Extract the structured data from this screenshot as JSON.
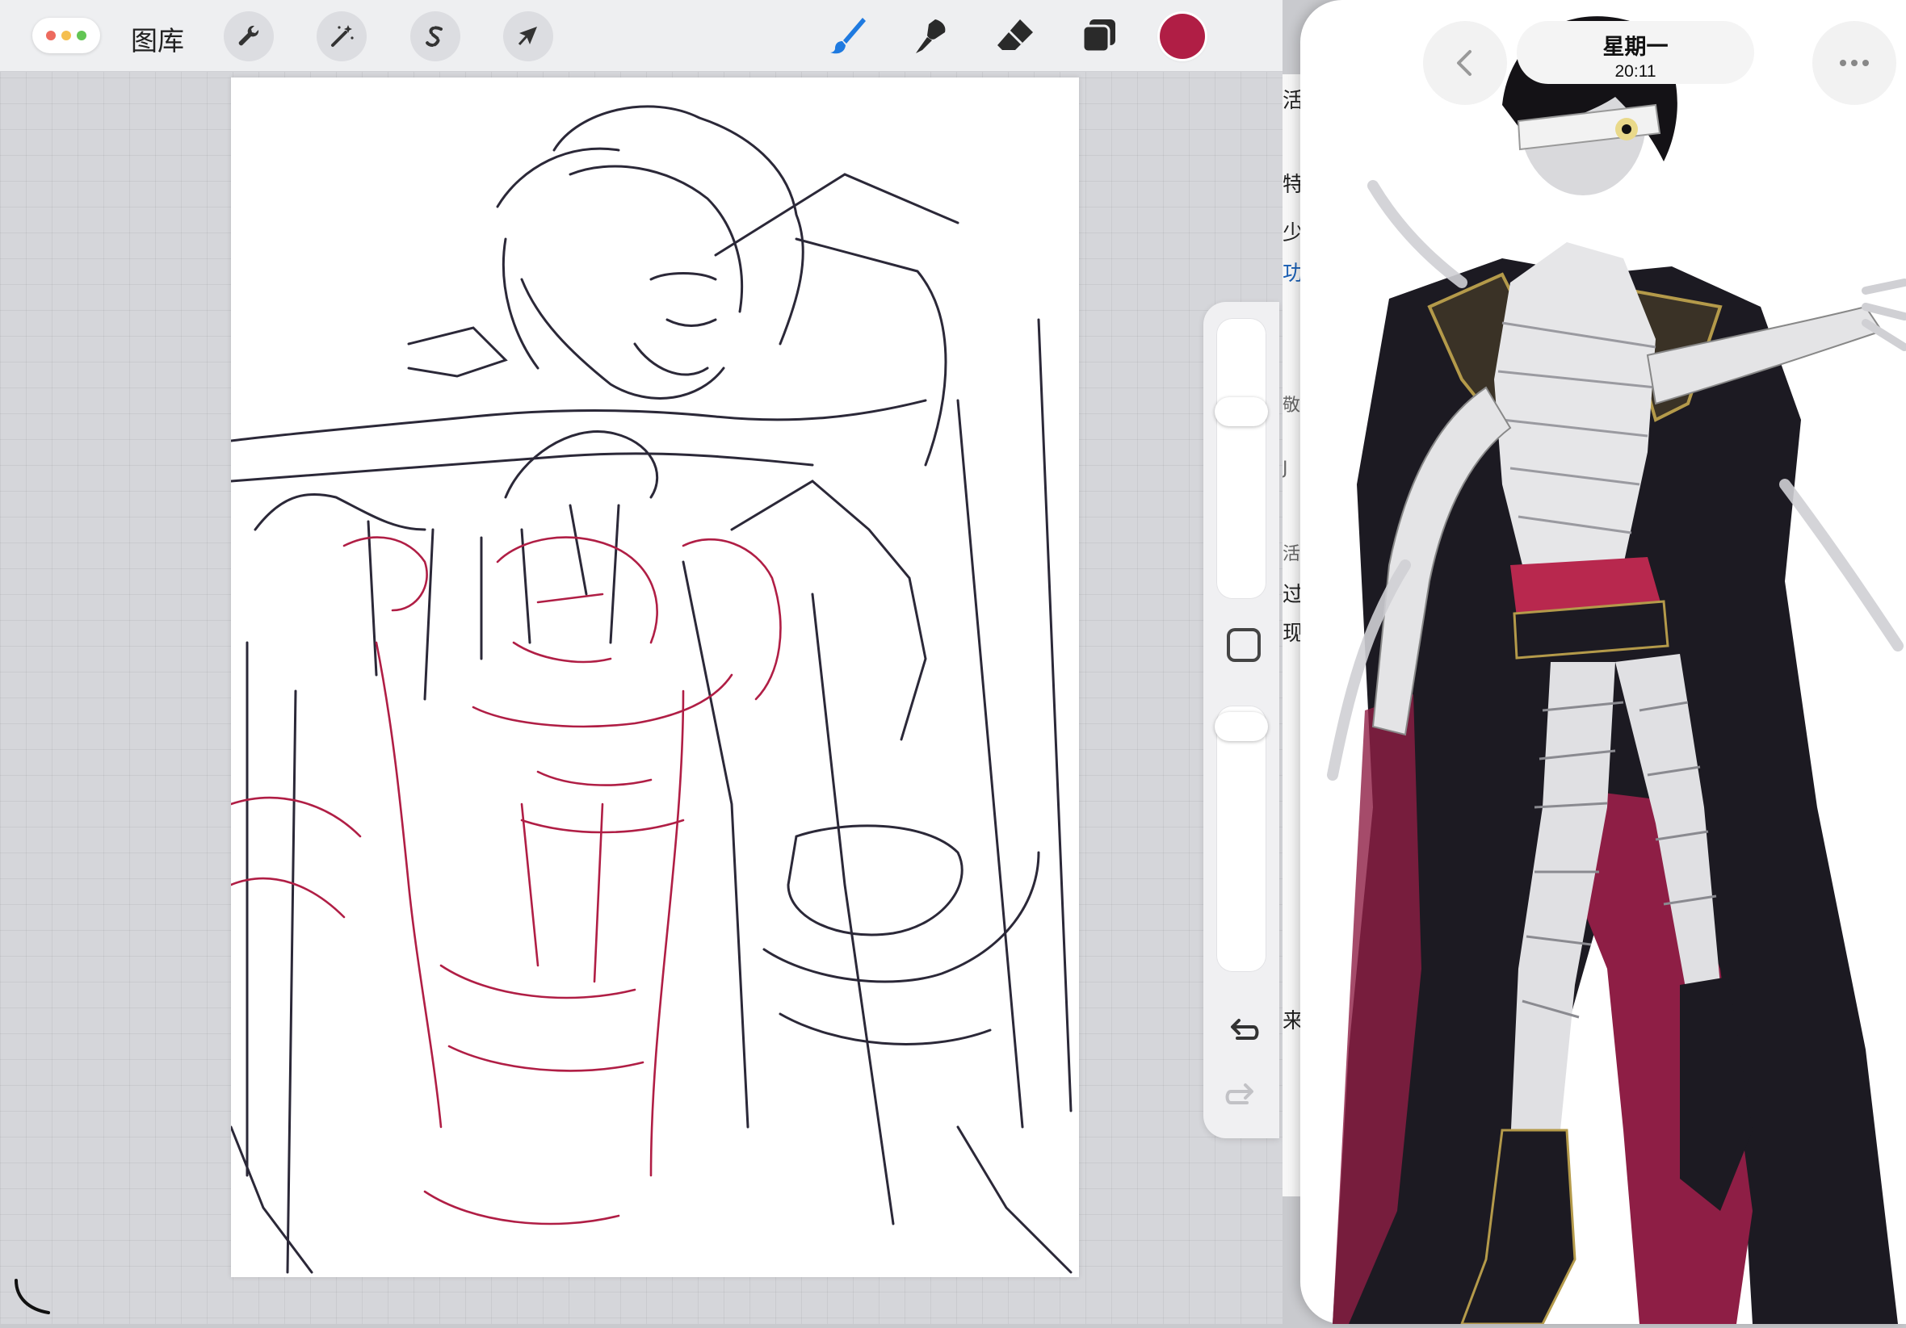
{
  "procreate": {
    "gallery_label": "图库",
    "window_dots": [
      "#ed6a5e",
      "#f5bf4f",
      "#62c554"
    ],
    "left_tools": [
      "wrench-icon",
      "magic-wand-icon",
      "selection-s-icon",
      "arrow-cursor-icon"
    ],
    "right_tools": [
      "brush-icon",
      "smudge-icon",
      "eraser-icon",
      "layers-icon"
    ],
    "active_tool_color": "#1f7ae0",
    "current_color": "#b01e45"
  },
  "safari": {
    "title": "星期一",
    "subtitle": "20:11",
    "back_icon": "chevron-left-icon",
    "more_icon": "ellipsis-icon",
    "peek_text": [
      "活",
      "特",
      "少",
      "功",
      "敬",
      "J",
      "活",
      "过",
      "现",
      "来"
    ]
  }
}
